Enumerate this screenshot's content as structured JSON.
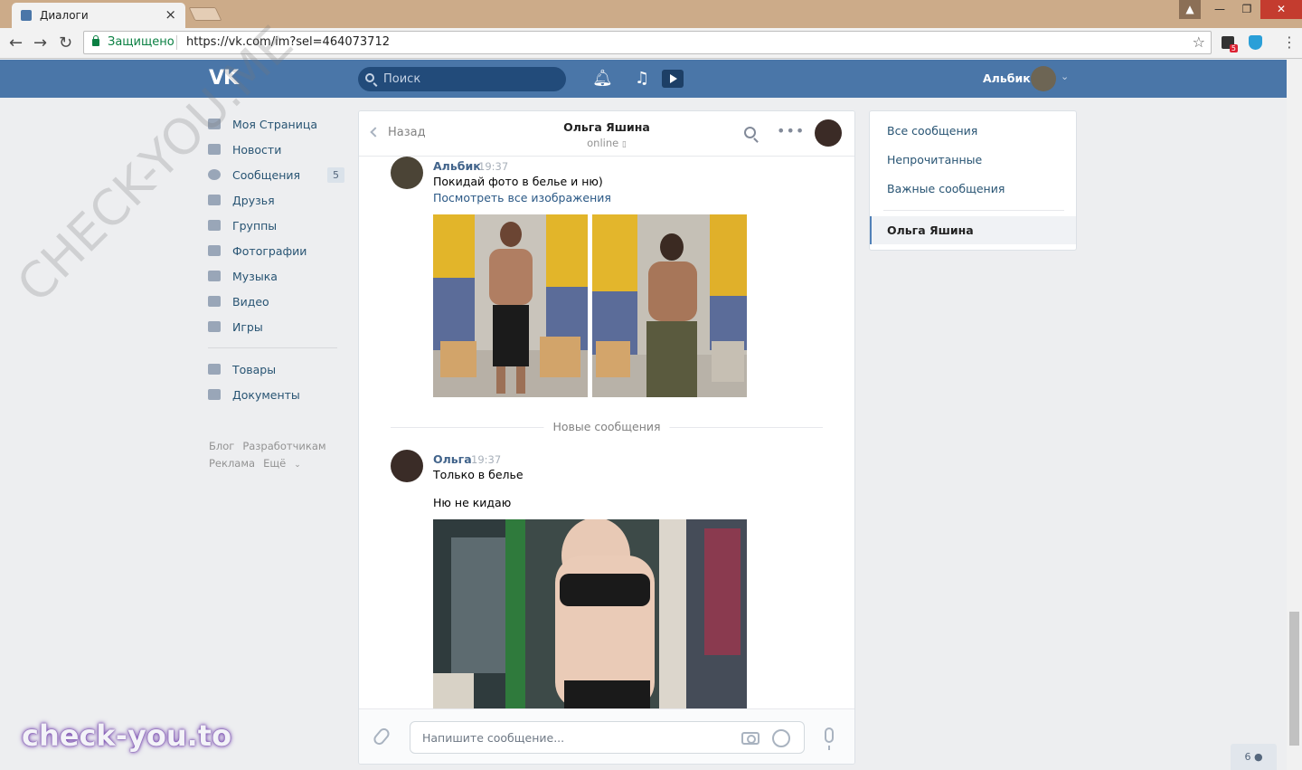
{
  "browser": {
    "tab_title": "Диалоги",
    "secure_label": "Защищено",
    "url": "https://vk.com/im?sel=464073712",
    "extension_badge": "5"
  },
  "header": {
    "search_placeholder": "Поиск",
    "user_name": "Альбик",
    "logo": "VK"
  },
  "sidebar": {
    "items": [
      {
        "label": "Моя Страница",
        "icon": "home-icon"
      },
      {
        "label": "Новости",
        "icon": "news-icon"
      },
      {
        "label": "Сообщения",
        "icon": "messages-icon",
        "count": "5"
      },
      {
        "label": "Друзья",
        "icon": "friends-icon"
      },
      {
        "label": "Группы",
        "icon": "groups-icon"
      },
      {
        "label": "Фотографии",
        "icon": "camera-icon"
      },
      {
        "label": "Музыка",
        "icon": "music-icon"
      },
      {
        "label": "Видео",
        "icon": "video-icon"
      },
      {
        "label": "Игры",
        "icon": "games-icon"
      }
    ],
    "items2": [
      {
        "label": "Товары",
        "icon": "bag-icon"
      },
      {
        "label": "Документы",
        "icon": "document-icon"
      }
    ],
    "footer": [
      "Блог",
      "Разработчикам",
      "Реклама",
      "Ещё"
    ]
  },
  "chat": {
    "back_label": "Назад",
    "peer_name": "Ольга Яшина",
    "peer_status": "online",
    "messages": [
      {
        "author": "Альбик",
        "time": "19:37",
        "text": "Покидай фото в белье и ню)",
        "link": "Посмотреть все изображения"
      },
      {
        "author": "Ольга",
        "time": "19:37",
        "text": "Только в белье",
        "text2": "Ню не кидаю"
      }
    ],
    "new_messages_label": "Новые сообщения",
    "composer_placeholder": "Напишите сообщение..."
  },
  "right_panel": {
    "filters": [
      "Все сообщения",
      "Непрочитанные",
      "Важные сообщения"
    ],
    "active_dialog": "Ольга Яшина"
  },
  "online_counter": "6",
  "watermarks": {
    "diagonal": "CHECK-YOU.ME",
    "logo": "check-you.to"
  },
  "colors": {
    "vk_blue": "#4a76a8",
    "link": "#2a5885",
    "author": "#42648b"
  }
}
